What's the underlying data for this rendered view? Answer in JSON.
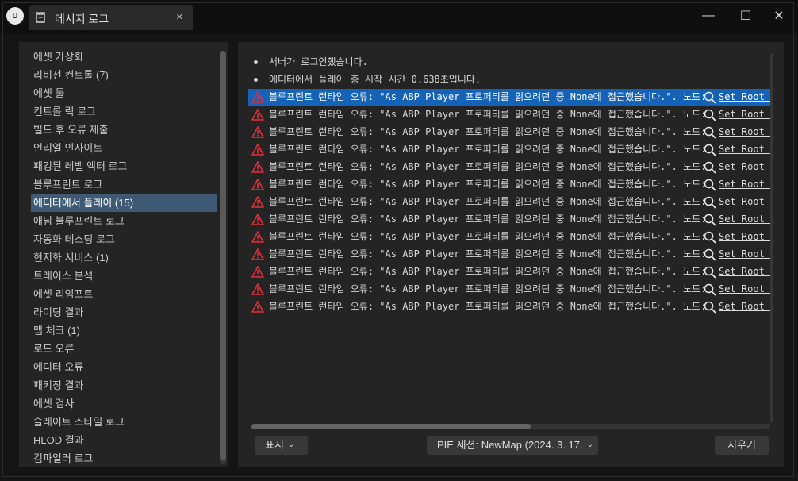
{
  "window": {
    "logo_text": "U",
    "tab_title": "메시지 로그",
    "tab_close": "×",
    "minimize": "—",
    "maximize": "☐",
    "close": "✕"
  },
  "categories": [
    {
      "label": "에셋 가상화",
      "selected": false
    },
    {
      "label": "리비전 컨트롤 (7)",
      "selected": false
    },
    {
      "label": "에셋 툴",
      "selected": false
    },
    {
      "label": "컨트롤 릭 로그",
      "selected": false
    },
    {
      "label": "빌드 후 오류 제출",
      "selected": false
    },
    {
      "label": "언리얼 인사이트",
      "selected": false
    },
    {
      "label": "패킹된 레벨 액터 로그",
      "selected": false
    },
    {
      "label": "블루프린트 로그",
      "selected": false
    },
    {
      "label": "에디터에서 플레이 (15)",
      "selected": true
    },
    {
      "label": "애님 블루프린트 로그",
      "selected": false
    },
    {
      "label": "자동화 테스팅 로그",
      "selected": false
    },
    {
      "label": "현지화 서비스 (1)",
      "selected": false
    },
    {
      "label": "트레이스 분석",
      "selected": false
    },
    {
      "label": "에셋 리임포트",
      "selected": false
    },
    {
      "label": "라이팅 결과",
      "selected": false
    },
    {
      "label": "맵 체크 (1)",
      "selected": false
    },
    {
      "label": "로드 오류",
      "selected": false
    },
    {
      "label": "에디터 오류",
      "selected": false
    },
    {
      "label": "패키징 결과",
      "selected": false
    },
    {
      "label": "에셋 검사",
      "selected": false
    },
    {
      "label": "슬레이트 스타일 로그",
      "selected": false
    },
    {
      "label": "HLOD 결과",
      "selected": false
    },
    {
      "label": "컴파일러 로그",
      "selected": false
    }
  ],
  "log": {
    "info_messages": [
      "서버가 로그인했습니다.",
      "에디터에서 플레이 층 시작 시간 0.638초입니다."
    ],
    "error_message": "블루프린트 런타임 오류: \"As ABP Player 프로퍼티를 읽으려던 중 None에 접근했습니다.\". 노드:",
    "link_text": "Set Root Motion Mode",
    "error_count": 13,
    "selected_error_index": 0,
    "colors": {
      "selected_row": "#1463b8",
      "warning": "#e0303a"
    }
  },
  "toolbar": {
    "show_label": "표시",
    "session_label": "PIE 세션: NewMap (2024. 3. 17.",
    "clear_label": "지우기",
    "chevron": "⌄"
  }
}
